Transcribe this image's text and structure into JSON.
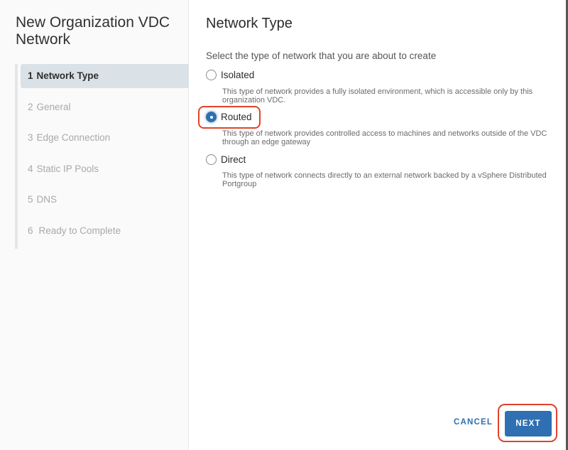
{
  "wizard": {
    "title": "New Organization VDC Network",
    "steps": [
      {
        "num": "1",
        "label": "Network Type",
        "active": true
      },
      {
        "num": "2",
        "label": "General",
        "active": false
      },
      {
        "num": "3",
        "label": "Edge Connection",
        "active": false
      },
      {
        "num": "4",
        "label": "Static IP Pools",
        "active": false
      },
      {
        "num": "5",
        "label": "DNS",
        "active": false
      },
      {
        "num": "6",
        "label": "Ready to Complete",
        "active": false
      }
    ]
  },
  "main": {
    "title": "Network Type",
    "prompt": "Select the type of network that you are about to create",
    "options": [
      {
        "label": "Isolated",
        "selected": false,
        "description": "This type of network provides a fully isolated environment, which is accessible only by this organization VDC."
      },
      {
        "label": "Routed",
        "selected": true,
        "description": "This type of network provides controlled access to machines and networks outside of the VDC through an edge gateway"
      },
      {
        "label": "Direct",
        "selected": false,
        "description": "This type of network connects directly to an external network backed by a vSphere Distributed Portgroup"
      }
    ]
  },
  "footer": {
    "cancel_label": "CANCEL",
    "next_label": "NEXT"
  },
  "colors": {
    "accent": "#2e70b2",
    "highlight": "#e0432b",
    "active_step_bg": "#dbe2e7"
  }
}
